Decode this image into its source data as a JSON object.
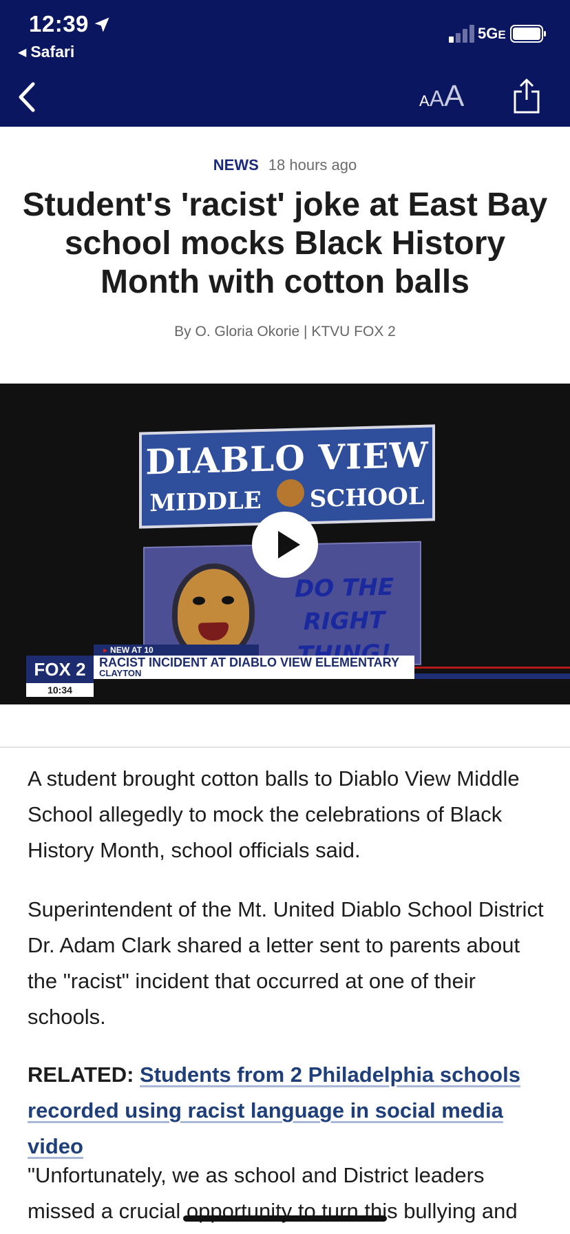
{
  "status_bar": {
    "time": "12:39",
    "back_app": "Safari",
    "network": "5G",
    "network_suffix": "E"
  },
  "toolbar": {
    "text_size_label": "AAA",
    "icons": [
      "back-chevron-icon",
      "text-size-icon",
      "share-icon"
    ]
  },
  "article": {
    "category": "NEWS",
    "time_ago": "18 hours ago",
    "headline": "Student's 'racist' joke at East Bay school mocks Black History Month with cotton balls",
    "byline": "By O. Gloria Okorie | KTVU FOX 2",
    "video": {
      "sign_title": "DIABLO VIEW",
      "sign_sub_left": "MIDDLE",
      "sign_sub_right": "SCHOOL",
      "board_text_line1": "DO THE",
      "board_text_line2": "RIGHT THING!",
      "channel_logo": "FOX 2",
      "timestamp": "10:34",
      "tag": "NEW AT 10",
      "lower_third_headline": "RACIST INCIDENT AT DIABLO VIEW ELEMENTARY",
      "lower_third_place": "CLAYTON"
    },
    "paragraphs": [
      "A student brought cotton balls to Diablo View Middle School allegedly to mock the celebrations of Black History Month, school officials said.",
      "Superintendent of the Mt. United Diablo School District Dr. Adam Clark shared a letter sent to parents about the \"racist\" incident that occurred at one of their schools.",
      "\"Unfortunately, we as school and District leaders missed a crucial opportunity to turn this bullying and"
    ],
    "related": {
      "label": "RELATED:",
      "link_text": "Students from 2 Philadelphia schools recorded using racist language in social media video"
    }
  },
  "colors": {
    "nav_bg": "#0b1660",
    "category": "#1b2a7c",
    "link": "#1f3f7a"
  }
}
